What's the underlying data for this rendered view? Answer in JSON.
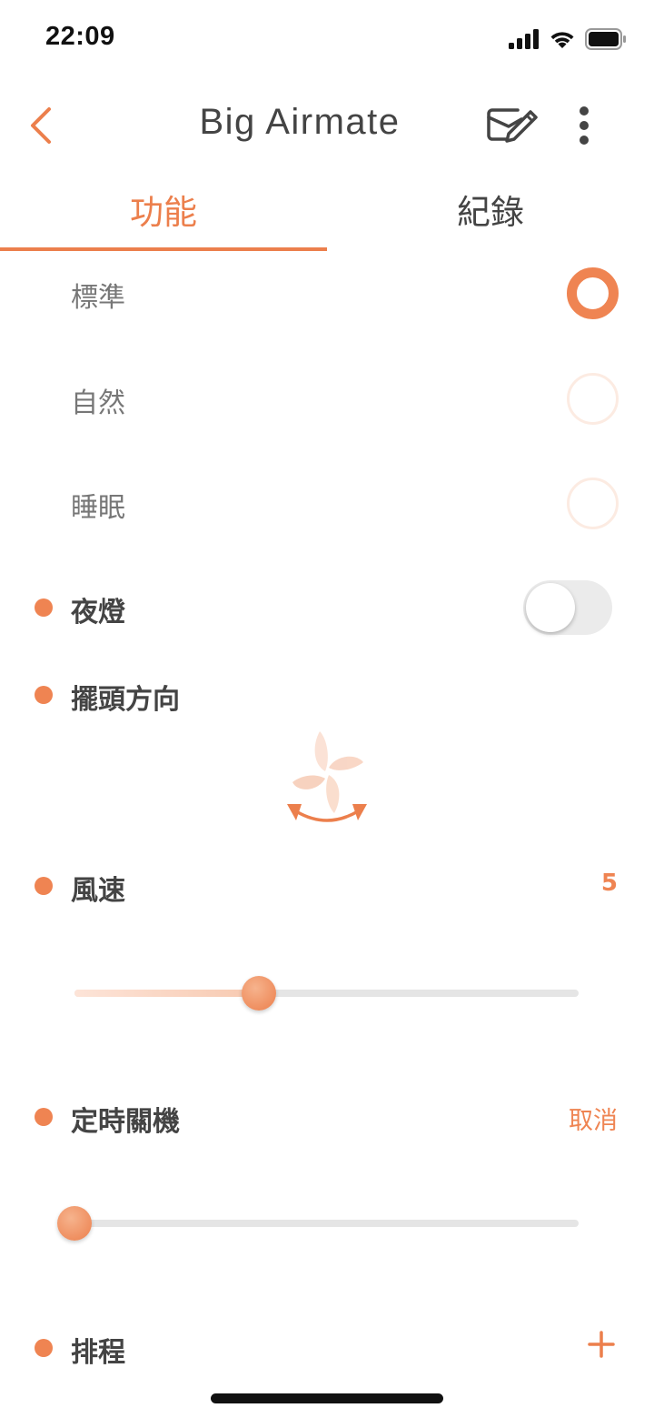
{
  "status_bar": {
    "time": "22:09"
  },
  "nav": {
    "title": "Big Airmate"
  },
  "tabs": [
    {
      "label": "功能",
      "active": true
    },
    {
      "label": "紀錄",
      "active": false
    }
  ],
  "modes": [
    {
      "label": "標準",
      "selected": true
    },
    {
      "label": "自然",
      "selected": false
    },
    {
      "label": "睡眠",
      "selected": false
    }
  ],
  "night_light": {
    "label": "夜燈",
    "on": false
  },
  "swing": {
    "label": "擺頭方向"
  },
  "fan_speed": {
    "label": "風速",
    "value": "5",
    "fraction": 0.365
  },
  "timer": {
    "label": "定時關機",
    "cancel_label": "取消",
    "fraction": 0.0
  },
  "schedule": {
    "label": "排程"
  },
  "colors": {
    "accent": "#ef8452",
    "text": "#444444",
    "muted": "#777777",
    "track": "#e5e5e5"
  }
}
